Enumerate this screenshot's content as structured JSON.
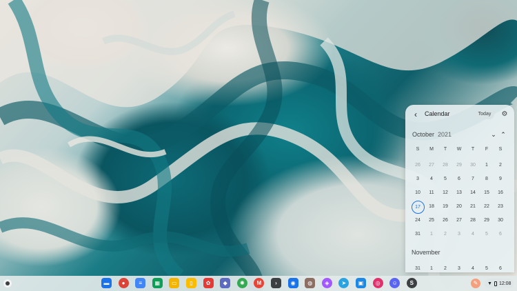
{
  "calendar": {
    "title": "Calendar",
    "today_label": "Today",
    "back_icon": "arrow-left-icon",
    "settings_icon": "gear-icon",
    "month": "October",
    "year": "2021",
    "weekdays": [
      "S",
      "M",
      "T",
      "W",
      "T",
      "F",
      "S"
    ],
    "weeks": [
      [
        "26",
        "27",
        "28",
        "29",
        "30",
        "1",
        "2"
      ],
      [
        "3",
        "4",
        "5",
        "6",
        "7",
        "8",
        "9"
      ],
      [
        "10",
        "11",
        "12",
        "13",
        "14",
        "15",
        "16"
      ],
      [
        "17",
        "18",
        "19",
        "20",
        "21",
        "22",
        "23"
      ],
      [
        "24",
        "25",
        "26",
        "27",
        "28",
        "29",
        "30"
      ],
      [
        "31",
        "1",
        "2",
        "3",
        "4",
        "5",
        "6"
      ]
    ],
    "selected_day": "17",
    "next_month": "November",
    "next_month_partial": [
      "31",
      "1",
      "2",
      "3",
      "4",
      "5",
      "6"
    ]
  },
  "shelf": {
    "apps": [
      {
        "name": "files-app",
        "color": "#1a73e8",
        "glyph": "▬"
      },
      {
        "name": "chrome-app",
        "color": "#db4437",
        "glyph": "●"
      },
      {
        "name": "docs-app",
        "color": "#4285f4",
        "glyph": "≡"
      },
      {
        "name": "sheets-app",
        "color": "#0f9d58",
        "glyph": "▦"
      },
      {
        "name": "slides-app",
        "color": "#f4b400",
        "glyph": "▭"
      },
      {
        "name": "keep-app",
        "color": "#fbbc04",
        "glyph": "▯"
      },
      {
        "name": "photos-editor-app",
        "color": "#e53935",
        "glyph": "✿"
      },
      {
        "name": "store-app",
        "color": "#5c6bc0",
        "glyph": "◆"
      },
      {
        "name": "photos-app",
        "color": "#34a853",
        "glyph": "✺"
      },
      {
        "name": "gmail-app",
        "color": "#ea4335",
        "glyph": "M"
      },
      {
        "name": "terminal-app",
        "color": "#3c4043",
        "glyph": "›"
      },
      {
        "name": "messages-app",
        "color": "#1a73e8",
        "glyph": "◉"
      },
      {
        "name": "contacts-app",
        "color": "#8d6e63",
        "glyph": "◍"
      },
      {
        "name": "figma-app",
        "color": "#a259ff",
        "glyph": "◈"
      },
      {
        "name": "telegram-app",
        "color": "#2aa3e0",
        "glyph": "➤"
      },
      {
        "name": "chat-app",
        "color": "#1e88e5",
        "glyph": "▣"
      },
      {
        "name": "instagram-app",
        "color": "#e1306c",
        "glyph": "◎"
      },
      {
        "name": "discord-app",
        "color": "#5865f2",
        "glyph": "☺"
      },
      {
        "name": "steam-app",
        "color": "#3c4043",
        "glyph": "S"
      }
    ],
    "tray_icon": "pen-icon",
    "wifi_icon": "wifi-icon",
    "battery_icon": "battery-icon",
    "time": "12:08"
  }
}
